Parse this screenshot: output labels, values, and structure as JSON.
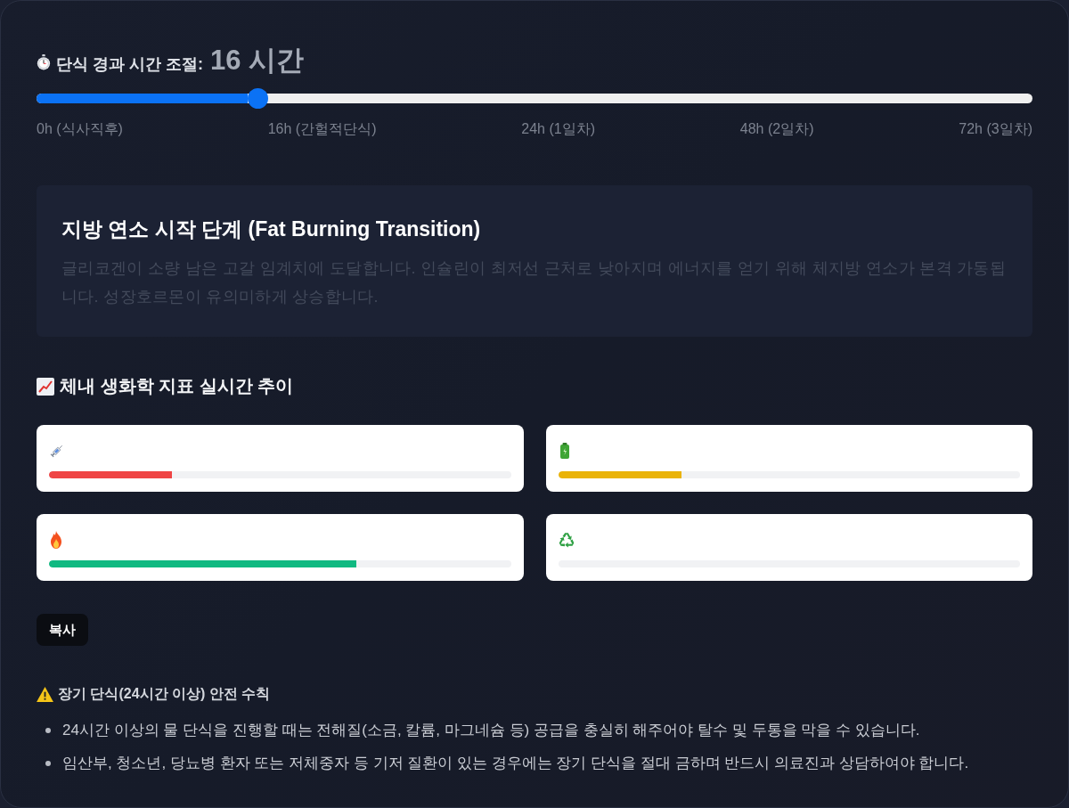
{
  "slider": {
    "label": "단식 경과 시간 조절:",
    "value": "16 시간",
    "level": 0.222,
    "ticks": [
      "0h (식사직후)",
      "16h (간헐적단식)",
      "24h (1일차)",
      "48h (2일차)",
      "72h (3일차)"
    ]
  },
  "phase": {
    "title": "지방 연소 시작 단계 (Fat Burning Transition)",
    "description": "글리코겐이 소량 남은 고갈 임계치에 도달합니다. 인슐린이 최저선 근처로 낮아지며 에너지를 얻기 위해 체지방 연소가 본격 가동됩니다. 성장호르몬이 유의미하게 상승합니다."
  },
  "metrics_section": {
    "title": "체내 생화학 지표 실시간 추이",
    "metrics": [
      {
        "kind": "syringe",
        "level": 0.267,
        "color": "#ef4444"
      },
      {
        "kind": "battery",
        "level": 0.267,
        "color": "#eab308"
      },
      {
        "kind": "fire",
        "level": 0.666,
        "color": "#10b981"
      },
      {
        "kind": "recycle"
      }
    ]
  },
  "copy_button": {
    "label": "복사"
  },
  "safety": {
    "title": "장기 단식(24시간 이상) 안전 수칙",
    "items": [
      "24시간 이상의 물 단식을 진행할 때는 전해질(소금, 칼륨, 마그네슘 등) 공급을 충실히 해주어야 탈수 및 두통을 막을 수 있습니다.",
      "임산부, 청소년, 당뇨병 환자 또는 저체중자 등 기저 질환이 있는 경우에는 장기 단식을 절대 금하며 반드시 의료진과 상담하여야 합니다."
    ]
  }
}
